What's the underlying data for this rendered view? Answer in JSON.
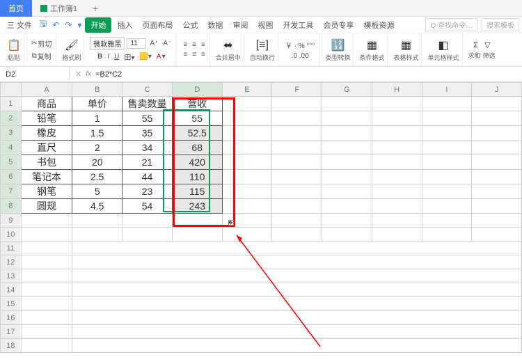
{
  "tabs": {
    "home": "首页",
    "workbook": "工作簿1",
    "add": "+"
  },
  "menu": {
    "file": "三 文件",
    "items": [
      "插入",
      "页面布局",
      "公式",
      "数据",
      "审阅",
      "视图",
      "开发工具",
      "会员专享",
      "模板资源"
    ],
    "start": "开始",
    "search1": "Q 查找命令…",
    "search2": "搜索模板"
  },
  "toolbar": {
    "cut": "剪切",
    "paste": "粘贴",
    "copy": "复制",
    "format_painter": "格式刷",
    "font": "微软雅黑",
    "size": "11",
    "merge": "合并居中",
    "wrap": "自动换行",
    "currency_group": "￥ · % °°°",
    "number_format": "类型转换",
    "cond_fmt": "条件格式",
    "table_style": "表格样式",
    "cell_style": "单元格样式",
    "sum": "求和",
    "filter": "筛选"
  },
  "formula": {
    "cell": "D2",
    "fx": "fx",
    "value": "=B2*C2"
  },
  "columns": [
    "A",
    "B",
    "C",
    "D",
    "E",
    "F",
    "G",
    "H",
    "I",
    "J"
  ],
  "headers": {
    "A": "商品",
    "B": "单价",
    "C": "售卖数量",
    "D": "营收"
  },
  "rows": [
    {
      "A": "铅笔",
      "B": "1",
      "C": "55",
      "D": "55"
    },
    {
      "A": "橡皮",
      "B": "1.5",
      "C": "35",
      "D": "52.5"
    },
    {
      "A": "直尺",
      "B": "2",
      "C": "34",
      "D": "68"
    },
    {
      "A": "书包",
      "B": "20",
      "C": "21",
      "D": "420"
    },
    {
      "A": "笔记本",
      "B": "2.5",
      "C": "44",
      "D": "110"
    },
    {
      "A": "钢笔",
      "B": "5",
      "C": "23",
      "D": "115"
    },
    {
      "A": "圆规",
      "B": "4.5",
      "C": "54",
      "D": "243"
    }
  ],
  "chart_data": {
    "type": "table",
    "columns": [
      "商品",
      "单价",
      "售卖数量",
      "营收"
    ],
    "data": [
      [
        "铅笔",
        1,
        55,
        55
      ],
      [
        "橡皮",
        1.5,
        35,
        52.5
      ],
      [
        "直尺",
        2,
        34,
        68
      ],
      [
        "书包",
        20,
        21,
        420
      ],
      [
        "笔记本",
        2.5,
        44,
        110
      ],
      [
        "钢笔",
        5,
        23,
        115
      ],
      [
        "圆规",
        4.5,
        54,
        243
      ]
    ]
  }
}
